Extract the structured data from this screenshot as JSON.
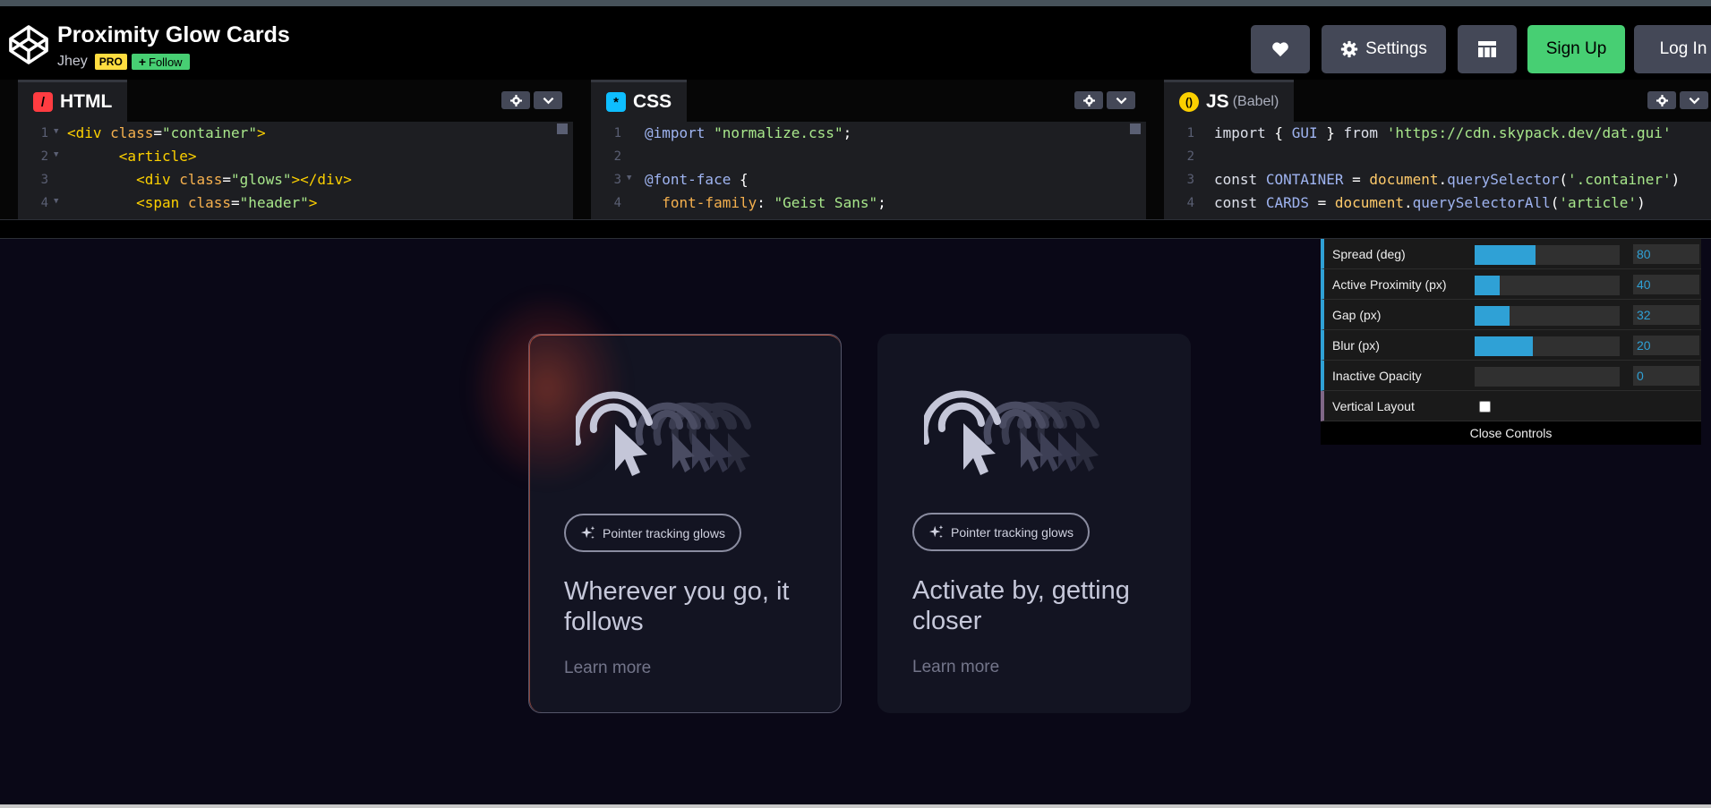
{
  "header": {
    "title": "Proximity Glow Cards",
    "author": "Jhey",
    "pro_badge": "PRO",
    "follow_label": "Follow",
    "settings_label": "Settings",
    "signup_label": "Sign Up",
    "login_label": "Log In"
  },
  "editors": {
    "html": {
      "label": "HTML",
      "lines": [
        {
          "n": "1",
          "text": "<div class=\"container\">"
        },
        {
          "n": "2",
          "text": "      <article>"
        },
        {
          "n": "3",
          "text": "        <div class=\"glows\"></div>"
        },
        {
          "n": "4",
          "text": "        <span class=\"header\">"
        }
      ]
    },
    "css": {
      "label": "CSS",
      "lines": [
        {
          "n": "1",
          "text": "@import \"normalize.css\";"
        },
        {
          "n": "2",
          "text": ""
        },
        {
          "n": "3",
          "text": "@font-face {"
        },
        {
          "n": "4",
          "text": "  font-family: \"Geist Sans\";"
        }
      ]
    },
    "js": {
      "label": "JS",
      "sublabel": "(Babel)",
      "lines": [
        {
          "n": "1",
          "text": "import { GUI } from 'https://cdn.skypack.dev/dat.gui'"
        },
        {
          "n": "2",
          "text": ""
        },
        {
          "n": "3",
          "text": "const CONTAINER = document.querySelector('.container')"
        },
        {
          "n": "4",
          "text": "const CARDS = document.querySelectorAll('article')"
        }
      ]
    }
  },
  "cards": [
    {
      "chip": "Pointer tracking glows",
      "title": "Wherever you go, it follows",
      "link": "Learn more"
    },
    {
      "chip": "Pointer tracking glows",
      "title": "Activate by, getting closer",
      "link": "Learn more"
    }
  ],
  "controls": {
    "rows": [
      {
        "label": "Spread (deg)",
        "value": "80",
        "fraction": 0.42
      },
      {
        "label": "Active Proximity (px)",
        "value": "40",
        "fraction": 0.17
      },
      {
        "label": "Gap (px)",
        "value": "32",
        "fraction": 0.24
      },
      {
        "label": "Blur (px)",
        "value": "20",
        "fraction": 0.4
      },
      {
        "label": "Inactive Opacity",
        "value": "0",
        "fraction": 0.0
      }
    ],
    "vertical_label": "Vertical Layout",
    "vertical_checked": false,
    "close_label": "Close Controls"
  },
  "icons": {
    "logo": "codepen-logo-icon",
    "heart": "heart-icon",
    "settings": "gear-icon",
    "layout": "layout-grid-icon",
    "chip": "sparkle-icon",
    "card": "pointer-glow-icon"
  },
  "colors": {
    "accent": "#2fa1d6",
    "signup": "#47cf73",
    "pro": "#ffdd40",
    "html": "#ff3c41",
    "css": "#0ebeff",
    "js": "#fcd000"
  }
}
